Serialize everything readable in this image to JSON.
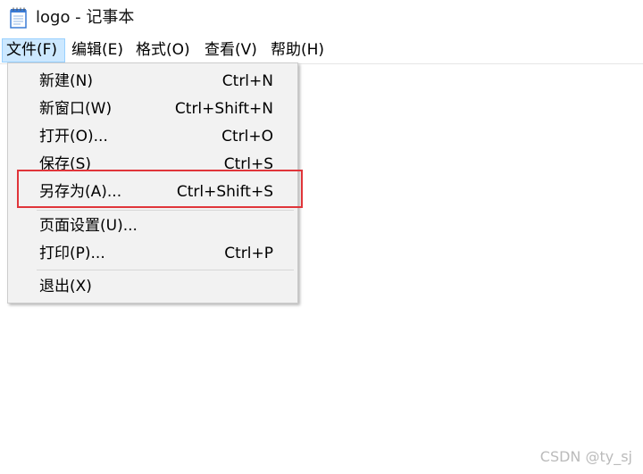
{
  "window": {
    "title": "logo - 记事本",
    "icon": "notepad-icon"
  },
  "menubar": {
    "items": [
      {
        "label": "文件(F)",
        "active": true
      },
      {
        "label": "编辑(E)"
      },
      {
        "label": "格式(O)"
      },
      {
        "label": "查看(V)"
      },
      {
        "label": "帮助(H)"
      }
    ]
  },
  "file_menu": {
    "items": [
      {
        "label": "新建(N)",
        "shortcut": "Ctrl+N"
      },
      {
        "label": "新窗口(W)",
        "shortcut": "Ctrl+Shift+N"
      },
      {
        "label": "打开(O)...",
        "shortcut": "Ctrl+O"
      },
      {
        "label": "保存(S)",
        "shortcut": "Ctrl+S"
      },
      {
        "label": "另存为(A)...",
        "shortcut": "Ctrl+Shift+S",
        "highlighted": true
      },
      {
        "label": "页面设置(U)...",
        "shortcut": ""
      },
      {
        "label": "打印(P)...",
        "shortcut": "Ctrl+P"
      },
      {
        "label": "退出(X)",
        "shortcut": ""
      }
    ]
  },
  "annotation": {
    "color": "#e0353a"
  },
  "watermark": {
    "text": "CSDN @ty_sj"
  },
  "colors": {
    "menu_active_bg": "#cce8ff",
    "menu_bg": "#f2f2f2"
  }
}
